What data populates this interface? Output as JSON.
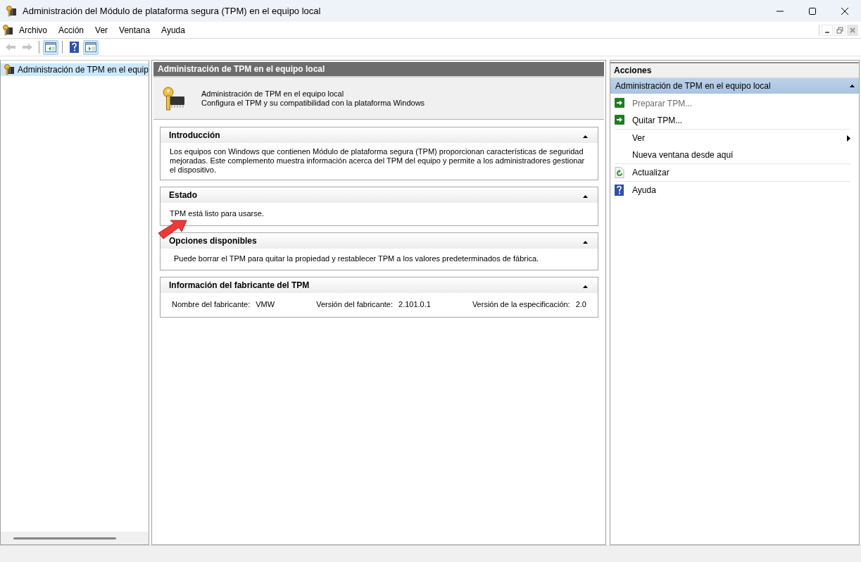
{
  "window": {
    "title": "Administración del Módulo de plataforma segura (TPM) en el equipo local"
  },
  "menu": [
    "Archivo",
    "Acción",
    "Ver",
    "Ventana",
    "Ayuda"
  ],
  "toolbar": [
    {
      "kind": "back",
      "disabled": true,
      "selected": false
    },
    {
      "kind": "forward",
      "disabled": true,
      "selected": false
    },
    {
      "kind": "tree",
      "disabled": false,
      "selected": true
    },
    {
      "kind": "help",
      "disabled": false,
      "selected": false
    },
    {
      "kind": "actionpane",
      "disabled": false,
      "selected": true
    }
  ],
  "tree": {
    "items": [
      {
        "label": "Administración de TPM en el equip",
        "selected": true
      }
    ]
  },
  "center": {
    "header": "Administración de TPM en el equipo local",
    "intro_title": "Administración de TPM en el equipo local",
    "intro_subtitle": "Configura el TPM y su compatibilidad con la plataforma Windows",
    "sections": [
      {
        "kind": "text",
        "title": "Introducción",
        "expanded": true,
        "text": "Los equipos con Windows que contienen Módulo de plataforma segura (TPM) proporcionan características de seguridad mejoradas. Este complemento muestra información acerca del TPM del equipo y permite a los administradores gestionar el dispositivo."
      },
      {
        "kind": "text",
        "title": "Estado",
        "expanded": true,
        "text": "TPM está listo para usarse."
      },
      {
        "kind": "text",
        "title": "Opciones disponibles",
        "expanded": true,
        "text": "Puede borrar el TPM para quitar la propiedad y restablecer TPM a los valores predeterminados de fábrica."
      },
      {
        "kind": "fields",
        "title": "Información del fabricante del TPM",
        "expanded": true,
        "fields": [
          {
            "label": "Nombre del fabricante:",
            "value": "VMW"
          },
          {
            "label": "Versión del fabricante:",
            "value": "2.101.0.1"
          },
          {
            "label": "Versión de la especificación:",
            "value": "2.0"
          }
        ]
      }
    ]
  },
  "actions": {
    "title": "Acciones",
    "group": {
      "label": "Administración de TPM en el equipo local",
      "expanded": true
    },
    "items": [
      {
        "kind": "run",
        "label": "Preparar TPM...",
        "disabled": true,
        "divider_after": false
      },
      {
        "kind": "run",
        "label": "Quitar TPM...",
        "disabled": false,
        "divider_after": true
      },
      {
        "kind": "submenu",
        "label": "Ver",
        "disabled": false,
        "divider_after": false
      },
      {
        "kind": "plain",
        "label": "Nueva ventana desde aquí",
        "disabled": false,
        "divider_after": true
      },
      {
        "kind": "refresh",
        "label": "Actualizar",
        "disabled": false,
        "divider_after": true
      },
      {
        "kind": "help",
        "label": "Ayuda",
        "disabled": false,
        "divider_after": false
      }
    ]
  },
  "annotation": {
    "kind": "arrow"
  }
}
